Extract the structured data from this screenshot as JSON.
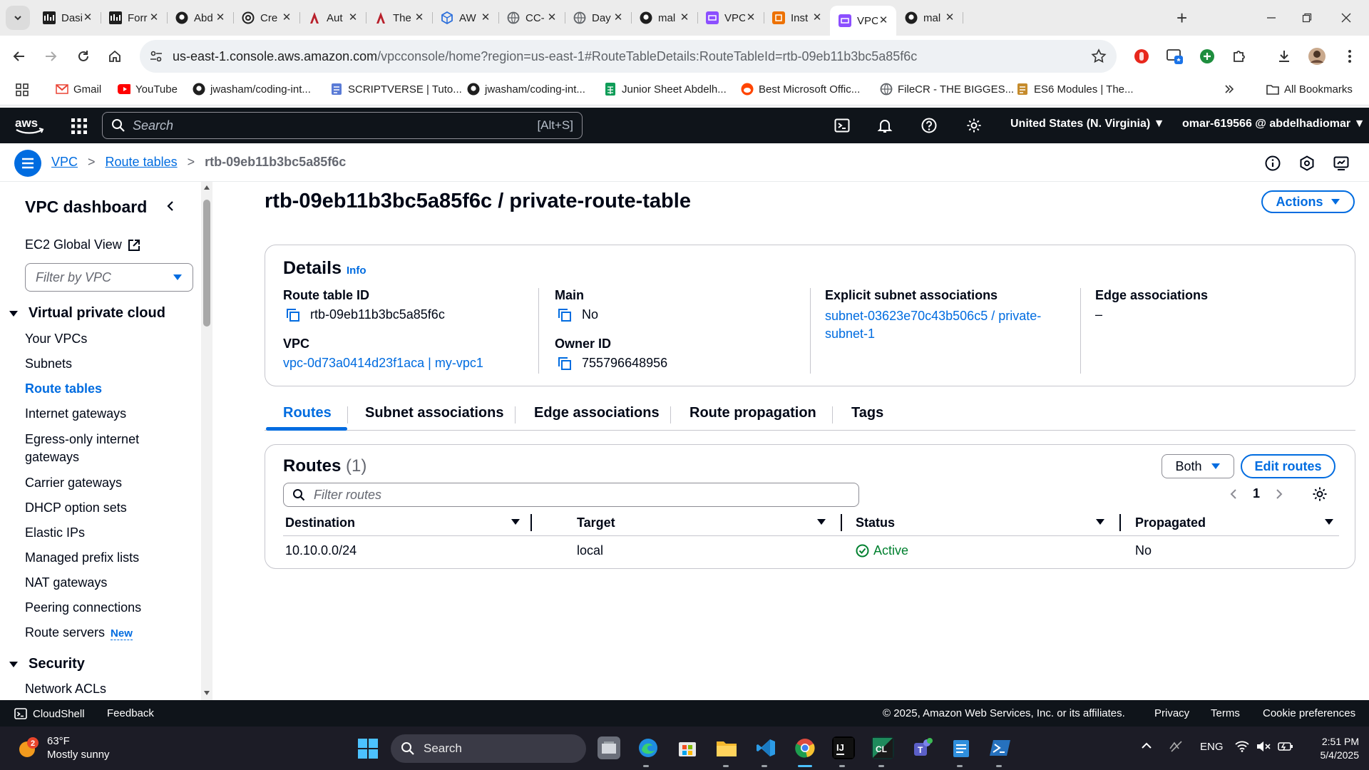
{
  "browser": {
    "tabs": [
      {
        "title": "Dasi",
        "icon": "dashboard-favicon"
      },
      {
        "title": "Forr",
        "icon": "dashboard-favicon"
      },
      {
        "title": "Abd",
        "icon": "github-icon"
      },
      {
        "title": "Cre",
        "icon": "openai-icon"
      },
      {
        "title": "Aut",
        "icon": "app-favicon"
      },
      {
        "title": "The",
        "icon": "app-favicon"
      },
      {
        "title": "AW",
        "icon": "cube-icon"
      },
      {
        "title": "CC-",
        "icon": "globe-icon"
      },
      {
        "title": "Day",
        "icon": "globe-icon"
      },
      {
        "title": "mal",
        "icon": "github-icon"
      },
      {
        "title": "VPC",
        "icon": "vpc-icon"
      },
      {
        "title": "Inst",
        "icon": "ec2-icon"
      },
      {
        "title": "VPC",
        "icon": "vpc-icon",
        "active": true
      },
      {
        "title": "mal",
        "icon": "github-icon"
      }
    ],
    "url_host": "us-east-1.console.aws.amazon.com",
    "url_path": "/vpcconsole/home?region=us-east-1#RouteTableDetails:RouteTableId=rtb-09eb11b3bc5a85f6c",
    "bookmarks": [
      {
        "label": "Gmail",
        "icon": "gmail-icon",
        "color": "#ea4335"
      },
      {
        "label": "YouTube",
        "icon": "youtube-icon",
        "color": "#ff0000"
      },
      {
        "label": "jwasham/coding-int...",
        "icon": "github-icon",
        "color": "#1f1f1f"
      },
      {
        "label": "SCRIPTVERSE | Tuto...",
        "icon": "page-icon",
        "color": "#5a7bd6"
      },
      {
        "label": "jwasham/coding-int...",
        "icon": "github-icon",
        "color": "#1f1f1f"
      },
      {
        "label": "Junior Sheet Abdelh...",
        "icon": "sheets-icon",
        "color": "#0f9d58"
      },
      {
        "label": "Best Microsoft Offic...",
        "icon": "reddit-icon",
        "color": "#ff4500"
      },
      {
        "label": "FileCR - THE BIGGES...",
        "icon": "globe-icon",
        "color": "#5f6368"
      },
      {
        "label": "ES6 Modules | The...",
        "icon": "page-icon",
        "color": "#c58b2c"
      }
    ],
    "all_bookmarks": "All Bookmarks"
  },
  "aws_header": {
    "logo": "aws",
    "search_placeholder": "Search",
    "search_shortcut": "[Alt+S]",
    "region": "United States (N. Virginia) ▼",
    "account": "omar-619566 @ abdelhadiomar ▼"
  },
  "breadcrumb": {
    "items": [
      "VPC",
      "Route tables"
    ],
    "current": "rtb-09eb11b3bc5a85f6c"
  },
  "sidebar": {
    "title": "VPC dashboard",
    "ec2_global_view": "EC2 Global View",
    "filter_placeholder": "Filter by VPC",
    "section_vpc": "Virtual private cloud",
    "items": [
      {
        "label": "Your VPCs"
      },
      {
        "label": "Subnets"
      },
      {
        "label": "Route tables",
        "active": true
      },
      {
        "label": "Internet gateways"
      },
      {
        "label": "Egress-only internet gateways"
      },
      {
        "label": "Carrier gateways"
      },
      {
        "label": "DHCP option sets"
      },
      {
        "label": "Elastic IPs"
      },
      {
        "label": "Managed prefix lists"
      },
      {
        "label": "NAT gateways"
      },
      {
        "label": "Peering connections"
      },
      {
        "label": "Route servers",
        "badge": "New"
      }
    ],
    "section_security": "Security",
    "security_items": [
      {
        "label": "Network ACLs"
      }
    ]
  },
  "page": {
    "title": "rtb-09eb11b3bc5a85f6c / private-route-table",
    "actions": "Actions"
  },
  "details": {
    "heading": "Details",
    "info": "Info",
    "route_table_id_label": "Route table ID",
    "route_table_id": "rtb-09eb11b3bc5a85f6c",
    "vpc_label": "VPC",
    "vpc": "vpc-0d73a0414d23f1aca | my-vpc1",
    "main_label": "Main",
    "main": "No",
    "owner_label": "Owner ID",
    "owner": "755796648956",
    "explicit_label": "Explicit subnet associations",
    "explicit_line1": "subnet-03623e70c43b506c5 / private-",
    "explicit_line2": "subnet-1",
    "edge_label": "Edge associations",
    "edge": "–"
  },
  "tabs": [
    "Routes",
    "Subnet associations",
    "Edge associations",
    "Route propagation",
    "Tags"
  ],
  "routes": {
    "heading": "Routes",
    "count": "(1)",
    "both": "Both",
    "edit": "Edit routes",
    "filter_placeholder": "Filter routes",
    "page": "1",
    "columns": [
      "Destination",
      "Target",
      "Status",
      "Propagated"
    ],
    "rows": [
      {
        "destination": "10.10.0.0/24",
        "target": "local",
        "status": "Active",
        "propagated": "No"
      }
    ]
  },
  "footer": {
    "cloudshell": "CloudShell",
    "feedback": "Feedback",
    "copyright": "© 2025, Amazon Web Services, Inc. or its affiliates.",
    "privacy": "Privacy",
    "terms": "Terms",
    "cookies": "Cookie preferences"
  },
  "taskbar": {
    "temp": "63°F",
    "weather": "Mostly sunny",
    "weather_badge": "2",
    "search": "Search",
    "lang": "ENG",
    "time": "2:51 PM",
    "date": "5/4/2025"
  },
  "colors": {
    "link": "#006ce0",
    "aws_dark": "#0f141a",
    "success": "#00802f"
  }
}
